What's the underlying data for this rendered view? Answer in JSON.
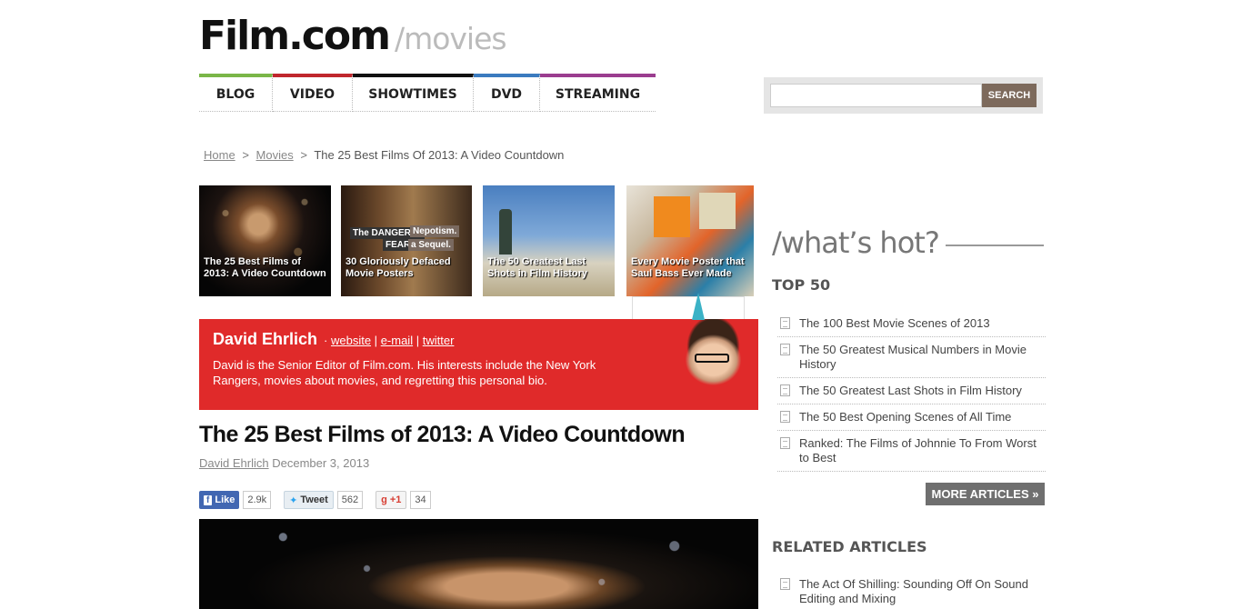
{
  "logo": {
    "main": "Film.com",
    "sub": "/movies"
  },
  "nav": [
    {
      "label": "BLOG",
      "color": "#7ab648",
      "width": 81
    },
    {
      "label": "VIDEO",
      "color": "#c0272d",
      "width": 88
    },
    {
      "label": "SHOWTIMES",
      "color": "#111111",
      "width": 133
    },
    {
      "label": "DVD",
      "color": "#3b7bbf",
      "width": 73
    },
    {
      "label": "STREAMING",
      "color": "#9b3d8f",
      "width": 127
    }
  ],
  "search": {
    "placeholder": "",
    "button": "SEARCH"
  },
  "breadcrumb": {
    "home": "Home",
    "sep1": ">",
    "movies": "Movies",
    "sep2": ">",
    "current": "The 25 Best Films Of 2013: A Video Countdown"
  },
  "thumbnails": [
    {
      "caption": "The 25 Best Films of 2013: A Video Countdown"
    },
    {
      "caption": "30 Gloriously Defaced Movie Posters",
      "poster_words": [
        "The DANGER IS",
        "Nepotism.",
        "FEAR",
        "a Sequel."
      ]
    },
    {
      "caption": "The 50 Greatest Last Shots in Film History"
    },
    {
      "caption": "Every Movie Poster that Saul Bass Ever Made"
    }
  ],
  "author": {
    "name": "David Ehrlich",
    "dot": "·",
    "website": "website",
    "email": "e-mail",
    "twitter": "twitter",
    "bar": "|",
    "bio": "David is the Senior Editor of Film.com. His interests include the New York Rangers, movies about movies, and regretting this personal bio."
  },
  "article": {
    "title": "The 25 Best Films of 2013: A Video Countdown",
    "author_link": "David Ehrlich",
    "date": "December 3, 2013"
  },
  "social": {
    "like": "Like",
    "like_count": "2.9k",
    "tweet": "Tweet",
    "tweet_count": "562",
    "gplus": "+1",
    "gplus_count": "34"
  },
  "sidebar": {
    "hot_title": "/what’s hot?",
    "top50_heading": "TOP 50",
    "top50": [
      "The 100 Best Movie Scenes of 2013",
      "The 50 Greatest Musical Numbers in Movie History",
      "The 50 Greatest Last Shots in Film History",
      "The 50 Best Opening Scenes of All Time",
      "Ranked: The Films of Johnnie To From Worst to Best"
    ],
    "more_button": "MORE ARTICLES »",
    "related_heading": "RELATED ARTICLES",
    "related": [
      "The Act Of Shilling: Sounding Off On Sound Editing and Mixing"
    ]
  }
}
